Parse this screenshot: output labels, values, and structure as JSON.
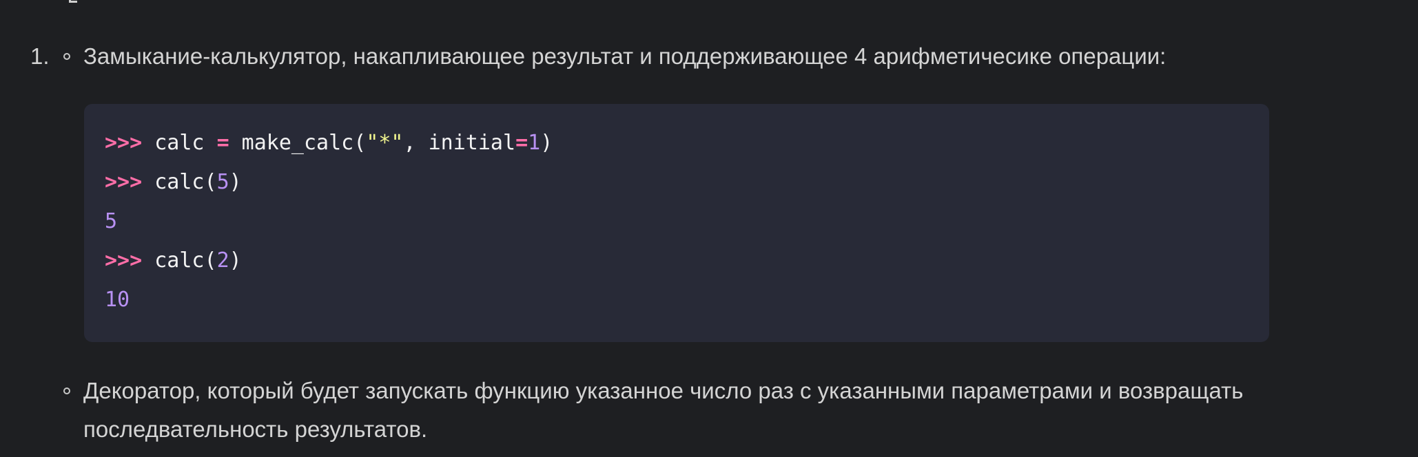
{
  "list": {
    "number": "1.",
    "item_one": "Замыкание-калькулятор, накапливающее результат и поддерживающее 4 арифметичесике операции:",
    "item_two": "Декоратор, который будет запускать функцию указанное число раз с указанными параметрами и возвращать последвательность результатов."
  },
  "code": {
    "line1": {
      "prompt": ">>>",
      "a": " calc ",
      "eq": "=",
      "b": " make_calc(",
      "str": "\"*\"",
      "c": ", initial",
      "eq2": "=",
      "num": "1",
      "d": ")"
    },
    "line2": {
      "prompt": ">>>",
      "a": " calc(",
      "num": "5",
      "b": ")"
    },
    "line3": {
      "out": "5"
    },
    "line4": {
      "prompt": ">>>",
      "a": " calc(",
      "num": "2",
      "b": ")"
    },
    "line5": {
      "out": "10"
    }
  },
  "colors": {
    "background": "#1e1f22",
    "code_background": "#282a37",
    "prompt": "#ff6ea8",
    "string": "#f1f58f",
    "number": "#b891f3"
  }
}
